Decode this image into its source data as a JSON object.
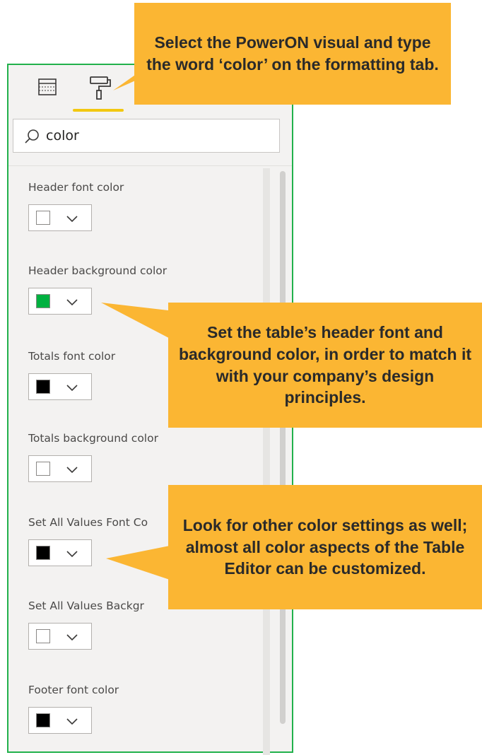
{
  "search": {
    "value": "color",
    "placeholder": "Search"
  },
  "tabs": [
    {
      "name": "fields",
      "icon": "table-fields-icon"
    },
    {
      "name": "format",
      "icon": "paint-roller-icon",
      "active": true
    }
  ],
  "settings": [
    {
      "label": "Header font color",
      "color": "#ffffff"
    },
    {
      "label": "Header background color",
      "color": "#00b140"
    },
    {
      "label": "Totals font color",
      "color": "#000000"
    },
    {
      "label": "Totals background color",
      "color": "#ffffff"
    },
    {
      "label": "Set All Values Font Co",
      "color": "#000000"
    },
    {
      "label": "Set All Values Backgr",
      "color": "#ffffff"
    },
    {
      "label": "Footer font color",
      "color": "#000000"
    }
  ],
  "callouts": {
    "top": "Select the PowerON visual and type the word ‘color’ on the formatting tab.",
    "middle": "Set the table’s header font and background color, in order to match it with your company’s design principles.",
    "bottom": "Look for other color settings as well; almost all color aspects of the Table Editor can be customized."
  },
  "colors": {
    "accent": "#f2c811",
    "pane_border": "#22b14c",
    "callout": "#fbb633"
  }
}
